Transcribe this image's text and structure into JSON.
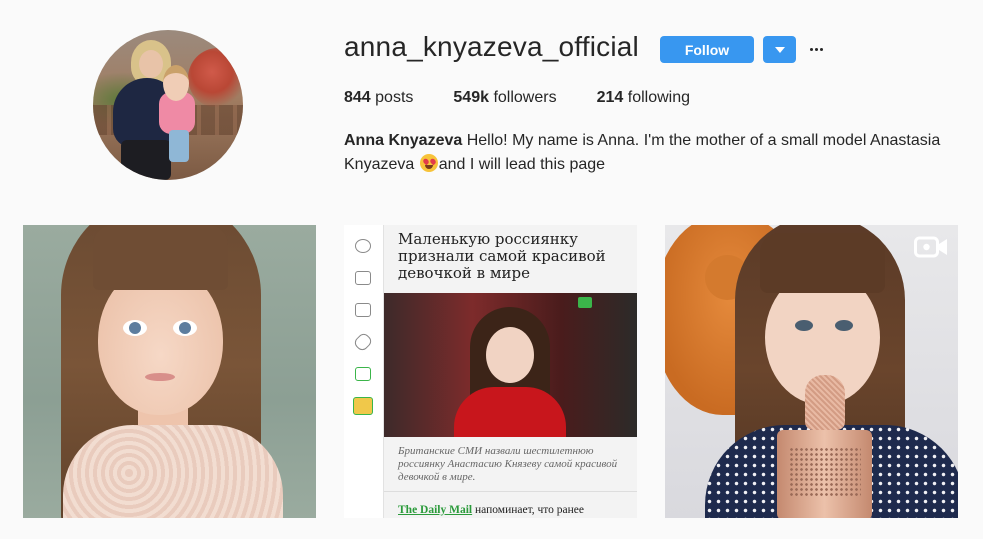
{
  "profile": {
    "username": "anna_knyazeva_official",
    "follow_label": "Follow",
    "posts_count": "844",
    "posts_label": "posts",
    "followers_count": "549k",
    "followers_label": "followers",
    "following_count": "214",
    "following_label": "following",
    "full_name": "Anna Knyazeva",
    "bio_part1": "Hello! My name is Anna. I'm the mother of a small model Anastasia Knyazeva ",
    "bio_emoji": "heart-eyes-emoji",
    "bio_part2": "and I will lead this page"
  },
  "posts": [
    {
      "type": "photo"
    },
    {
      "type": "photo",
      "headline": "Маленькую россиянку признали самой красивой девочкой в мире",
      "caption": "Британские СМИ назвали шестилетнюю россиянку Анастасию Князеву самой красивой девочкой в мире.",
      "source_link": "The Daily Mail",
      "source_rest": " напоминает, что ранее"
    },
    {
      "type": "video",
      "icon": "video-camera-icon"
    }
  ],
  "colors": {
    "accent": "#3897f0",
    "text": "#262626",
    "background": "#fafafa",
    "news_green": "#3bb54a"
  }
}
